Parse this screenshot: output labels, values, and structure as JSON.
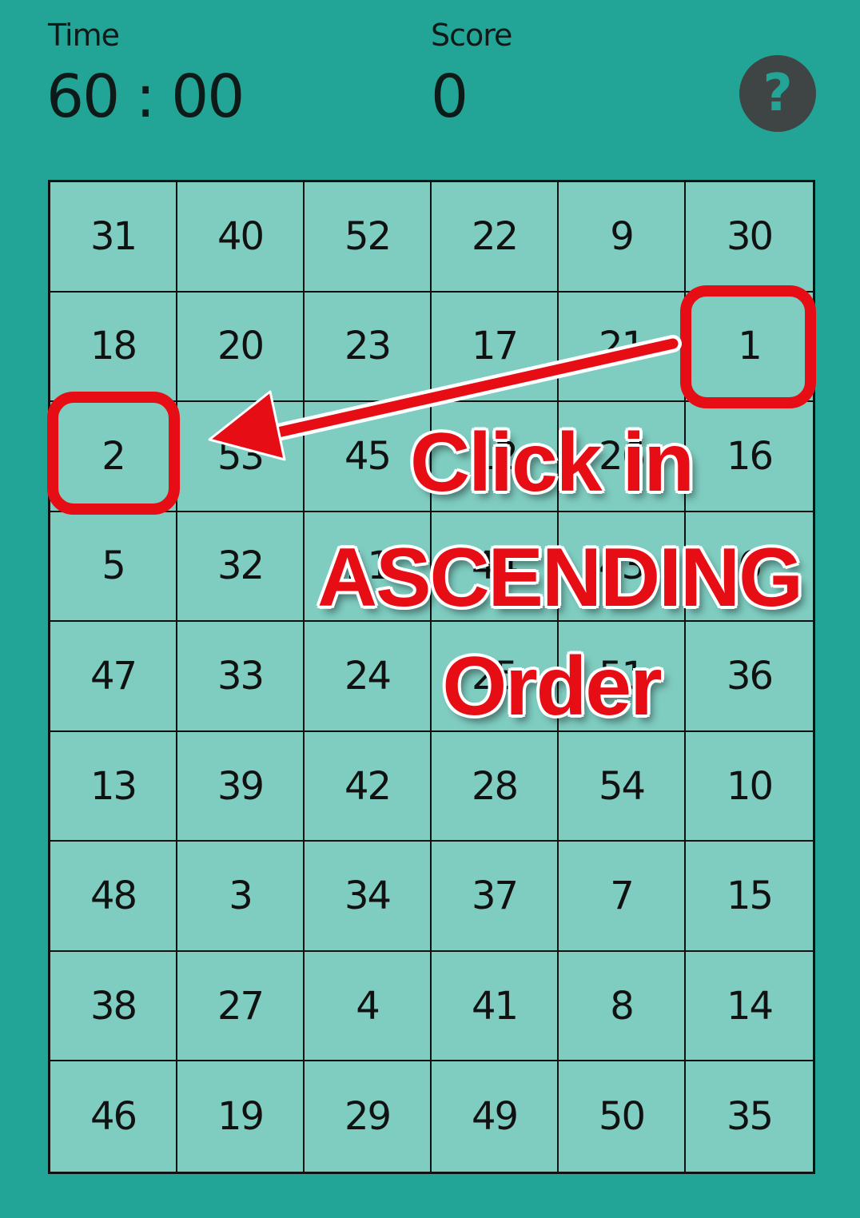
{
  "header": {
    "time_label": "Time",
    "time_value": "60 : 00",
    "score_label": "Score",
    "score_value": "0",
    "help_icon": "question-mark-icon",
    "help_glyph": "?"
  },
  "board": {
    "columns": 6,
    "rows": [
      [
        31,
        40,
        52,
        22,
        9,
        30
      ],
      [
        18,
        20,
        23,
        17,
        21,
        1
      ],
      [
        2,
        53,
        45,
        12,
        26,
        16
      ],
      [
        5,
        32,
        11,
        44,
        43,
        6
      ],
      [
        47,
        33,
        24,
        25,
        51,
        36
      ],
      [
        13,
        39,
        42,
        28,
        54,
        10
      ],
      [
        48,
        3,
        34,
        37,
        7,
        15
      ],
      [
        38,
        27,
        4,
        41,
        8,
        14
      ],
      [
        46,
        19,
        29,
        49,
        50,
        35
      ]
    ]
  },
  "hint": {
    "line1": "Click in",
    "line2": "ASCENDING",
    "line3": "Order",
    "highlight_color": "#e60e14",
    "arrow_icon": "arrow-left-icon"
  },
  "colors": {
    "background": "#22a596",
    "cell": "#7fcdc1",
    "grid_line": "#111111",
    "help_button": "#3e4544",
    "annotation_red": "#e60e14"
  }
}
